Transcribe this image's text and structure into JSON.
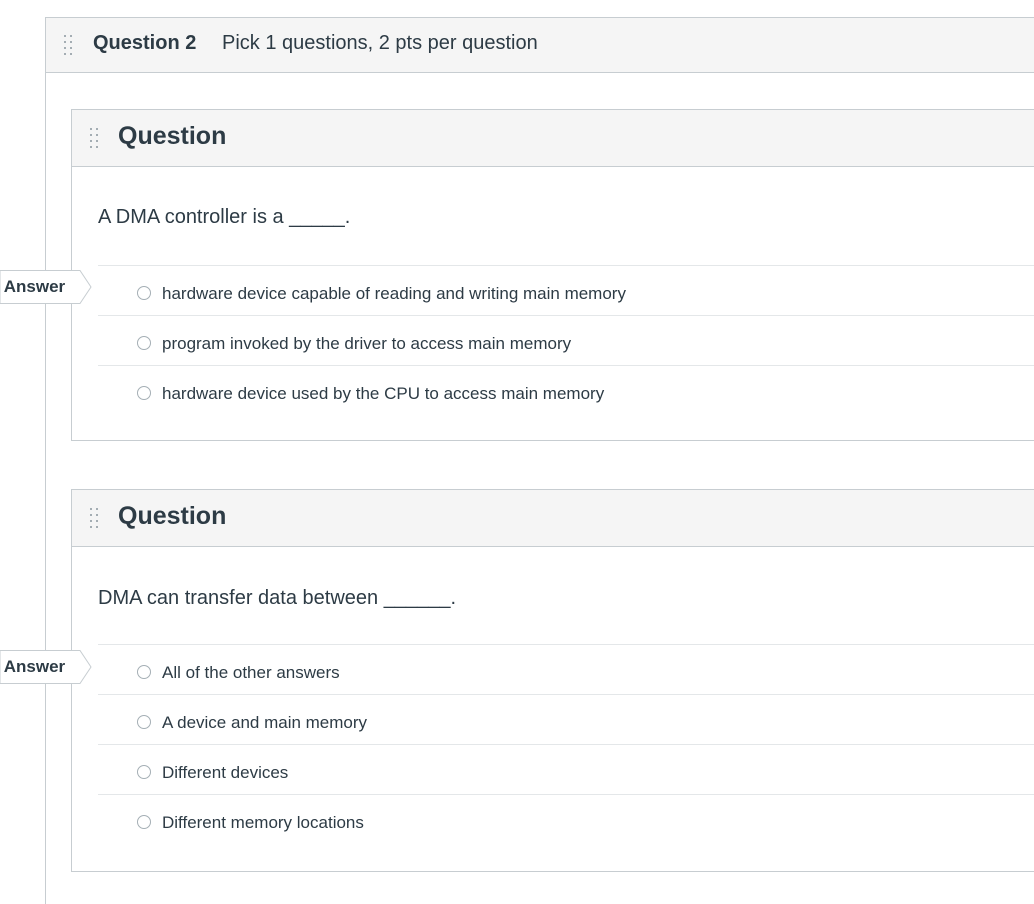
{
  "group": {
    "title": "Question 2",
    "description": "Pick 1 questions, 2 pts per question"
  },
  "questions": [
    {
      "title": "Question",
      "text": "A DMA controller is a _____.",
      "flag": "t Answer",
      "answers": [
        "hardware device capable of reading and writing main memory",
        "program invoked by the driver to access main memory",
        "hardware device used by the CPU to access main memory"
      ]
    },
    {
      "title": "Question",
      "text": "DMA can transfer data between ______.",
      "flag": "t Answer",
      "answers": [
        "All of the other answers",
        "A device and main memory",
        "Different devices",
        "Different memory locations"
      ]
    }
  ]
}
